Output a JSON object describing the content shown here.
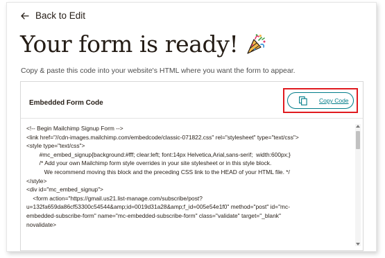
{
  "nav": {
    "back_label": "Back to Edit"
  },
  "page": {
    "title": "Your form is ready!",
    "subtitle": "Copy & paste this code into your website's HTML where you want the form to appear."
  },
  "code_panel": {
    "label": "Embedded Form Code",
    "copy_button_label": "Copy Code",
    "code_lines": [
      "<!-- Begin Mailchimp Signup Form -->",
      "<link href=\"//cdn-images.mailchimp.com/embedcode/classic-071822.css\" rel=\"stylesheet\" type=\"text/css\">",
      "<style type=\"text/css\">",
      "        #mc_embed_signup{background:#fff; clear:left; font:14px Helvetica,Arial,sans-serif;  width:600px;}",
      "        /* Add your own Mailchimp form style overrides in your site stylesheet or in this style block.",
      "           We recommend moving this block and the preceding CSS link to the HEAD of your HTML file. */",
      "</style>",
      "<div id=\"mc_embed_signup\">",
      "    <form action=\"https://gmail.us21.list-manage.com/subscribe/post?",
      "u=132fa659da86cf53300c54544&amp;id=0019d31a28&amp;f_id=005e54e1f0\" method=\"post\" id=\"mc-",
      "embedded-subscribe-form\" name=\"mc-embedded-subscribe-form\" class=\"validate\" target=\"_blank\"",
      "novalidate>"
    ]
  },
  "icons": {
    "back": "arrow-left-icon",
    "celebration": "party-popper-icon",
    "copy": "copy-icon"
  },
  "colors": {
    "accent": "#007c89",
    "highlight": "#e01a1f",
    "text": "#241c15"
  }
}
